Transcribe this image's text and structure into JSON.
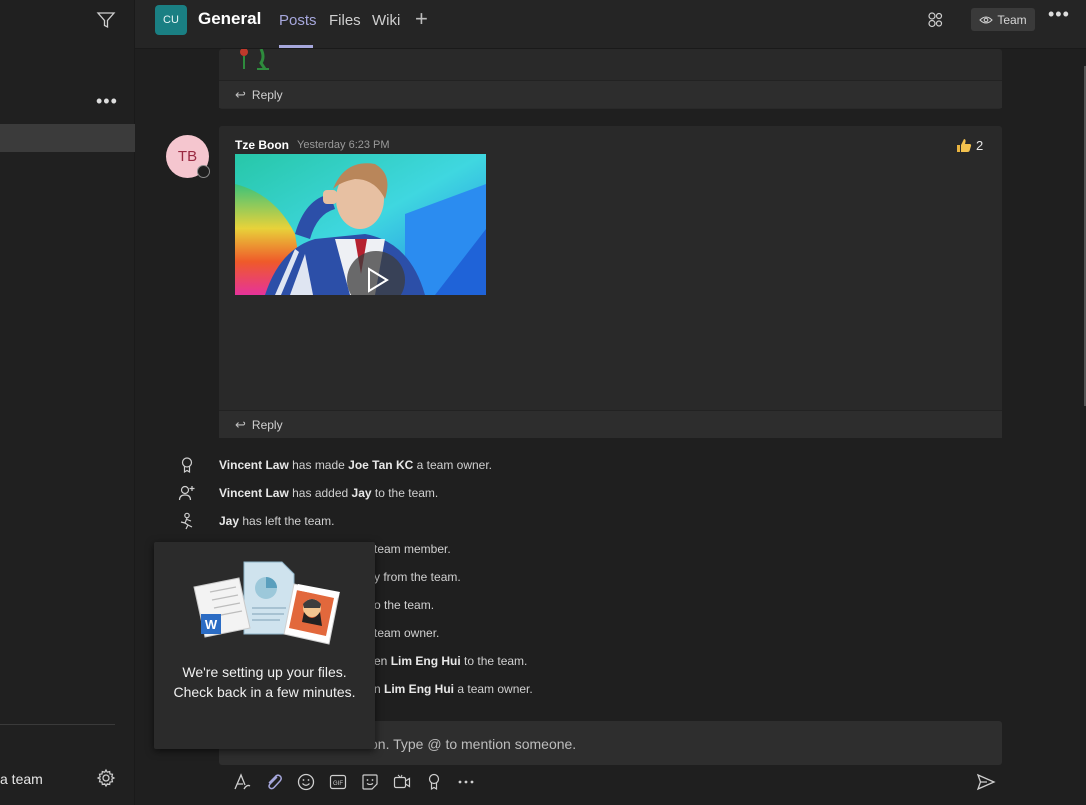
{
  "sidebar": {
    "filter_icon": "filter-icon",
    "more_label": "•••",
    "join_label": "a team",
    "gear_icon": "gear-icon"
  },
  "header": {
    "team_avatar": "CU",
    "title": "General",
    "tabs": [
      {
        "label": "Posts",
        "active": true
      },
      {
        "label": "Files",
        "active": false
      },
      {
        "label": "Wiki",
        "active": false
      }
    ],
    "add_tab": "+",
    "team_button": "Team",
    "more_label": "•••"
  },
  "posts": [
    {
      "reply_label": "Reply"
    },
    {
      "avatar_initials": "TB",
      "author": "Tze Boon",
      "time": "Yesterday 6:23 PM",
      "reaction_count": "2",
      "reply_label": "Reply"
    }
  ],
  "activity": [
    {
      "pre": "",
      "b1": "Vincent Law",
      "mid": " has made ",
      "b2": "Joe Tan KC",
      "post": " a team owner."
    },
    {
      "pre": "",
      "b1": "Vincent Law",
      "mid": " has added ",
      "b2": "Jay",
      "post": " to the team."
    },
    {
      "pre": "",
      "b1": "Jay",
      "mid": " has left the team.",
      "b2": "",
      "post": ""
    },
    {
      "pre": "team member.",
      "b1": "",
      "mid": "",
      "b2": "",
      "post": ""
    },
    {
      "pre": "y from the team.",
      "b1": "",
      "mid": "",
      "b2": "",
      "post": ""
    },
    {
      "pre": "o the team.",
      "b1": "",
      "mid": "",
      "b2": "",
      "post": ""
    },
    {
      "pre": "team owner.",
      "b1": "",
      "mid": "",
      "b2": "",
      "post": ""
    },
    {
      "pre": "en ",
      "b1": "Lim Eng Hui",
      "mid": " to the team.",
      "b2": "",
      "post": ""
    },
    {
      "pre": "n ",
      "b1": "Lim Eng Hui",
      "mid": " a team owner.",
      "b2": "",
      "post": ""
    }
  ],
  "files_popup": {
    "line1": "We're setting up your files.",
    "line2": "Check back in a few minutes."
  },
  "compose": {
    "placeholder": "on. Type @ to mention someone."
  },
  "colors": {
    "accent": "#a6a7dc",
    "team_avatar": "#1a7f83",
    "avatar_bg": "#f5c6cf"
  }
}
